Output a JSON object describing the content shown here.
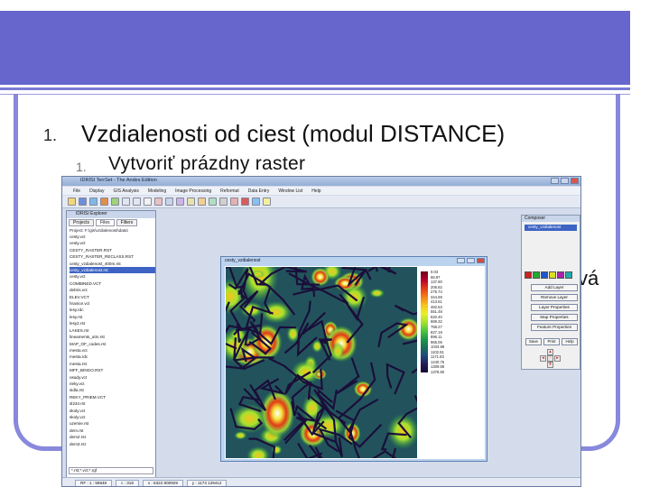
{
  "slide": {
    "bullet1_number": "1.",
    "bullet1_text": "Vzdialenosti od ciest (modul DISTANCE)",
    "bullet2_number": "1.",
    "bullet2_text": "Vytvoriť prázdny raster",
    "stray_text": "vá"
  },
  "app": {
    "title": "IDRISI TerrSet - The Andes Edition",
    "menu": [
      "File",
      "Display",
      "GIS Analysis",
      "Modeling",
      "Image Processing",
      "Reformat",
      "Data Entry",
      "Window List",
      "Help"
    ],
    "explorer": {
      "title": "IDRISI Explorer",
      "tabs": [
        "Projects",
        "Files",
        "Filters"
      ],
      "path": "Project: F:\\gis\\vzdialenosti\\data\\",
      "files": [
        "cesty.vct",
        "cesty.vct",
        "CESTY_RASTER.RST",
        "CESTY_RASTER_RECLASS.RST",
        "cesty_vzdialenost_400m.rst",
        "cesty_vzdialenost.rst",
        "cesty.vct",
        "COMBINED.VCT",
        "debris.vct",
        "ELEV.VCT",
        "hranice.vct",
        "lesy.rdc",
        "lesy.rst",
        "lesy2.rst",
        "LAKES.rst",
        "lineaments_utm.rst",
        "MAP_OF_codes.rst",
        "mesta.vct",
        "mesta.rdc",
        "mesta.rst",
        "MFF_BINGO.RST",
        "osady.vct",
        "rieky.vct",
        "sidla.rst",
        "REKY_PRIEM.VCT",
        "sl234.rst",
        "skoly.vct",
        "skoly.vct",
        "uzemie.rst",
        "dem.rst",
        "dem2.rst",
        "dem3.rst"
      ],
      "selected_file": "cesty_vzdialenost.rst",
      "filter_value": "*.rst;*.vct;*.rgf"
    },
    "map": {
      "window_title": "cesty_vzdialenost",
      "legend_values": [
        "0.03",
        "68.97",
        "137.90",
        "206.82",
        "275.74",
        "344.69",
        "413.61",
        "482.53",
        "551.48",
        "620.40",
        "689.32",
        "758.27",
        "827.19",
        "896.11",
        "965.06",
        "1033.98",
        "1102.91",
        "1171.83",
        "1240.75",
        "1309.68",
        "1378.60"
      ]
    },
    "composer": {
      "title": "Composer",
      "layer": "cesty_vzdialenost",
      "buttons": [
        "Add Layer",
        "Remove Layer",
        "Layer Properties",
        "Map Properties",
        "Feature Properties"
      ],
      "row_buttons": [
        "Save",
        "Print",
        "Help"
      ],
      "swatch_colors": [
        "#cc2222",
        "#22aa33",
        "#2255cc",
        "#dddd22",
        "#aa22aa",
        "#22aaaa"
      ]
    },
    "status": [
      "RF : 1 : 59648",
      "c : 318",
      "x : 6322 800929",
      "y : 1173 129412"
    ]
  }
}
